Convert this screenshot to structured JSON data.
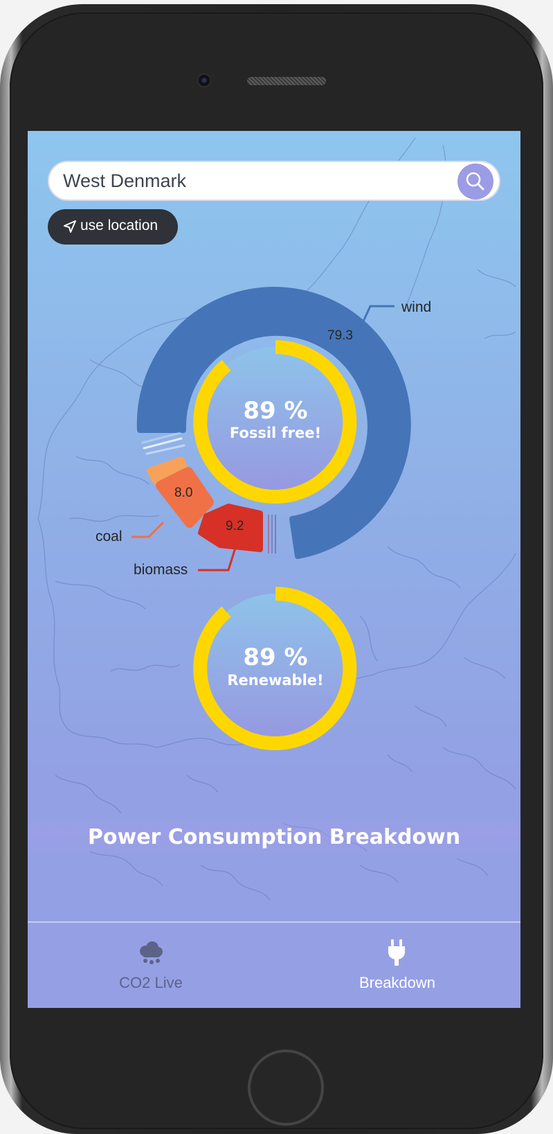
{
  "search": {
    "value": "West Denmark"
  },
  "location_button": {
    "label": "use location"
  },
  "donut": {
    "center_percent": "89 %",
    "center_caption": "Fossil free!",
    "segments": [
      {
        "name": "wind",
        "value": "79.3",
        "color": "#4575b8"
      },
      {
        "name": "coal",
        "value": "8.0",
        "color": "#f07146"
      },
      {
        "name": "biomass",
        "value": "9.2",
        "color": "#d73027"
      }
    ]
  },
  "renewable_ring": {
    "percent": "89 %",
    "caption": "Renewable!"
  },
  "section_title": "Power Consumption Breakdown",
  "tabs": [
    {
      "label": "CO2 Live",
      "icon": "cloud-icon",
      "active": false
    },
    {
      "label": "Breakdown",
      "icon": "plug-icon",
      "active": true
    }
  ],
  "colors": {
    "accent_ring": "#ffd700",
    "wind": "#4575b8",
    "coal": "#f07146",
    "biomass": "#d73027",
    "search_button": "#9c9be5"
  }
}
